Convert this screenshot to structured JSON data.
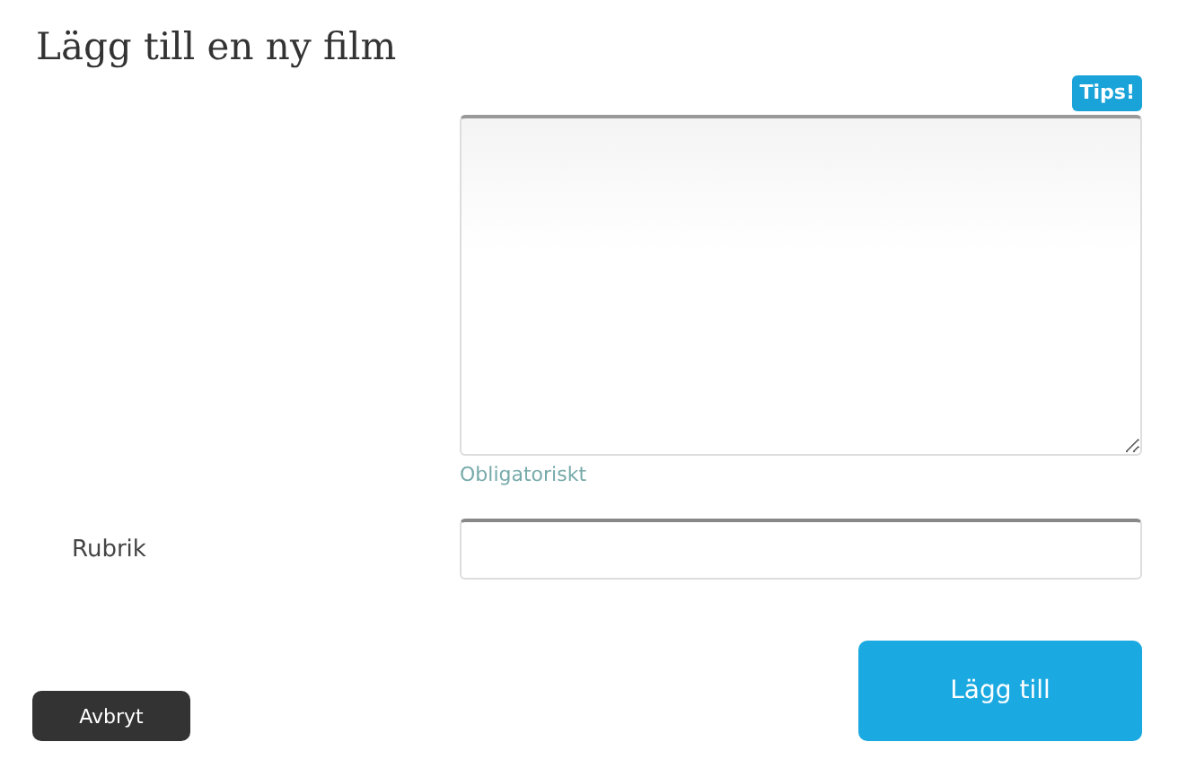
{
  "title": "Lägg till en ny film",
  "tip": "Tips!",
  "description": {
    "hint": "Obligatoriskt"
  },
  "fields": [
    {
      "label": "Rubrik"
    }
  ],
  "buttons": {
    "cancel": "Avbryt",
    "submit": "Lägg till"
  }
}
